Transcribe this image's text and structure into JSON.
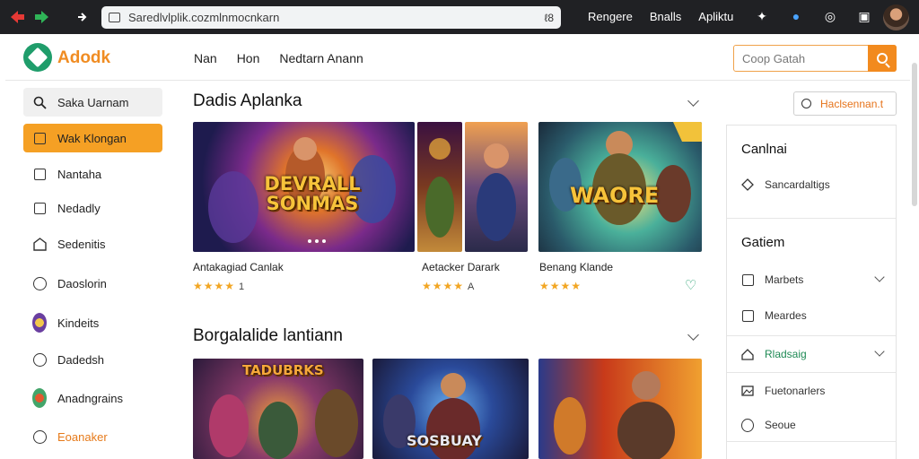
{
  "browser": {
    "url": "Saredlvlplik.cozmlnmocnkarn",
    "url_right": "ℓ8",
    "links": [
      "Rengere",
      "Bnalls",
      "Apliktu"
    ]
  },
  "header": {
    "brand": "Adodk",
    "nav": [
      "Nan",
      "Hon",
      "Nedtarn Anann"
    ],
    "search_placeholder": "Coop Gatah"
  },
  "sidebar": {
    "items": [
      {
        "label": "Saka Uarnam",
        "icon": "search-icon"
      },
      {
        "label": "Wak Klongan",
        "icon": "grid-icon"
      },
      {
        "label": "Nantaha",
        "icon": "info-icon"
      },
      {
        "label": "Nedadly",
        "icon": "check-icon"
      },
      {
        "label": "Sedenitis",
        "icon": "home-icon"
      },
      {
        "label": "Daoslorin",
        "icon": "circle-icon"
      },
      {
        "label": "Kindeits",
        "icon": "game-icon"
      },
      {
        "label": "Dadedsh",
        "icon": "circle-icon"
      },
      {
        "label": "Anadngrains",
        "icon": "game-icon"
      },
      {
        "label": "Eoanaker",
        "icon": "clock-icon"
      }
    ]
  },
  "main": {
    "section1": {
      "title": "Dadis Aplanka",
      "cards": [
        {
          "art": "DEVRALL SONMAS",
          "name": "Antakagiad Canlak",
          "stars": "★★★★",
          "rating": "1"
        },
        {
          "art": "",
          "name": "Aetacker Darark",
          "stars": "★★★★",
          "rating": "A"
        },
        {
          "art": "WAORE",
          "name": "Benang Klande",
          "stars": "★★★★",
          "rating": ""
        }
      ]
    },
    "section2": {
      "title": "Borgalalide lantiann",
      "cards": [
        {
          "art": "TADUBRKS"
        },
        {
          "art": "SOSBUAY"
        },
        {
          "art": ""
        }
      ]
    }
  },
  "right_panel": {
    "filter_label": "Haclsennan.t",
    "title1": "Canlnai",
    "item1": "Sancardaltigs",
    "title2": "Gatiem",
    "items": [
      {
        "label": "Marbets",
        "has_chevron": true
      },
      {
        "label": "Meardes",
        "has_chevron": false
      },
      {
        "label": "Rladsaig",
        "has_chevron": true,
        "green": true
      },
      {
        "label": "Fuetonarlers",
        "has_chevron": false
      },
      {
        "label": "Seoue",
        "has_chevron": false
      }
    ]
  },
  "colors": {
    "accent": "#f5a024",
    "brand_green": "#1f9d6b",
    "star": "#f2a623"
  }
}
